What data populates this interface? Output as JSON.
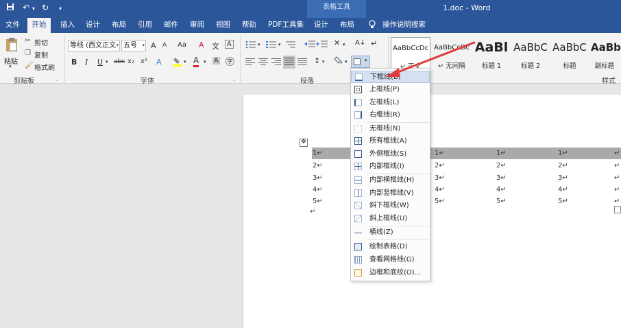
{
  "window": {
    "contextual_tools": "表格工具",
    "doc_title": "1.doc  -  Word"
  },
  "quick_access": {
    "save_icon": "save-icon",
    "undo_icon": "undo-icon",
    "redo_icon": "redo-icon",
    "customize_icon": "customize-icon"
  },
  "tabs": [
    "文件",
    "开始",
    "插入",
    "设计",
    "布局",
    "引用",
    "邮件",
    "审阅",
    "视图",
    "帮助",
    "PDF工具集",
    "设计",
    "布局"
  ],
  "tell_me": "操作说明搜索",
  "clipboard": {
    "paste": "粘贴",
    "cut": "剪切",
    "copy": "复制",
    "format_painter": "格式刷",
    "group": "剪贴板"
  },
  "font": {
    "name": "等线 (西文正文",
    "size": "五号",
    "group": "字体",
    "bold": "B",
    "italic": "I",
    "underline": "U",
    "strike": "abc",
    "sub": "x₂",
    "sup": "x²",
    "grow": "A",
    "shrink": "A",
    "case": "Aa",
    "clear": "A",
    "color_a": "A",
    "shade_a": "A"
  },
  "paragraph": {
    "group": "段落"
  },
  "styles": {
    "group": "样式",
    "items": [
      {
        "sample": "AaBbCcDc",
        "name": "↵ 正文"
      },
      {
        "sample": "AaBbCcDc",
        "name": "↵ 无间隔"
      },
      {
        "sample": "AaBl",
        "name": "标题 1"
      },
      {
        "sample": "AaBbC",
        "name": "标题 2"
      },
      {
        "sample": "AaBbC",
        "name": "标题"
      },
      {
        "sample": "AaBbl",
        "name": "副标题"
      }
    ]
  },
  "table": {
    "rows": [
      [
        "1↵",
        "1↵",
        "1↵",
        "1↵",
        "↵"
      ],
      [
        "2↵",
        "2↵",
        "2↵",
        "2↵",
        "↵"
      ],
      [
        "3↵",
        "3↵",
        "3↵",
        "3↵",
        "↵"
      ],
      [
        "4↵",
        "4↵",
        "4↵",
        "4↵",
        "↵"
      ],
      [
        "5↵",
        "5↵",
        "5↵",
        "5↵",
        "↵"
      ]
    ],
    "after_mark": "↵"
  },
  "border_menu": {
    "items": [
      {
        "label": "下框线(B)",
        "icon": "border-bottom-icon"
      },
      {
        "label": "上框线(P)",
        "icon": "border-top-icon"
      },
      {
        "label": "左框线(L)",
        "icon": "border-left-icon"
      },
      {
        "label": "右框线(R)",
        "icon": "border-right-icon"
      },
      {
        "label": "无框线(N)",
        "icon": "border-none-icon"
      },
      {
        "label": "所有框线(A)",
        "icon": "border-all-icon"
      },
      {
        "label": "外侧框线(S)",
        "icon": "border-outside-icon"
      },
      {
        "label": "内部框线(I)",
        "icon": "border-inside-icon"
      },
      {
        "label": "内部横框线(H)",
        "icon": "border-inside-horizontal-icon"
      },
      {
        "label": "内部竖框线(V)",
        "icon": "border-inside-vertical-icon"
      },
      {
        "label": "斜下框线(W)",
        "icon": "diagonal-down-border-icon"
      },
      {
        "label": "斜上框线(U)",
        "icon": "diagonal-up-border-icon"
      },
      {
        "label": "横线(Z)",
        "icon": "horizontal-line-icon"
      },
      {
        "label": "绘制表格(D)",
        "icon": "draw-table-icon"
      },
      {
        "label": "查看网格线(G)",
        "icon": "view-gridlines-icon"
      },
      {
        "label": "边框和底纹(O)...",
        "icon": "borders-shading-icon"
      }
    ]
  },
  "colors": {
    "title_bar": "#2b579a",
    "menu_hover": "#d5e1f2",
    "annotation_arrow": "#e03c3c",
    "row_highlight": "#aaaaaa"
  }
}
